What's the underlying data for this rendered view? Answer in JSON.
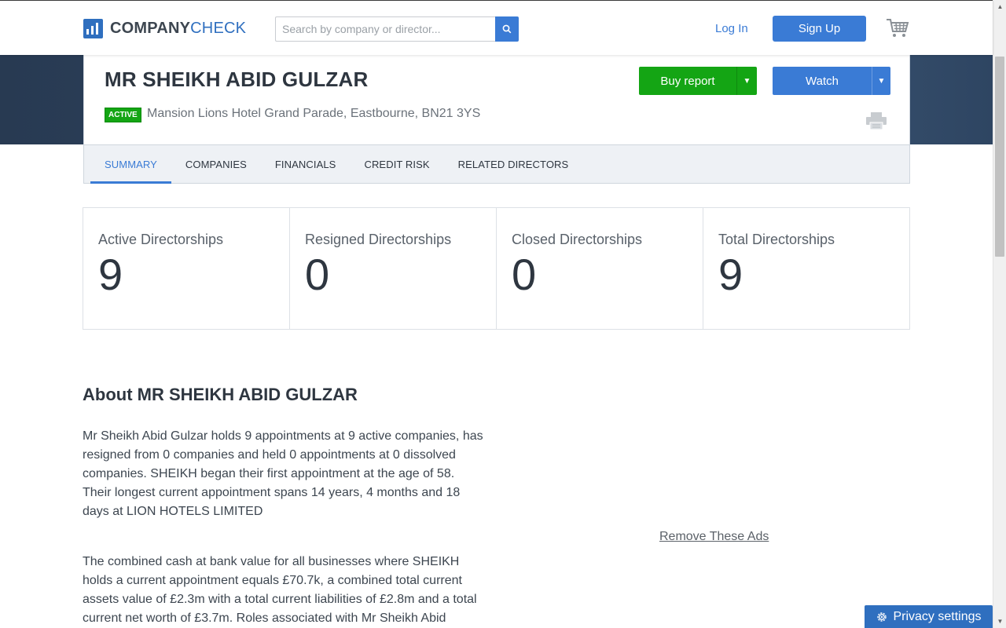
{
  "header": {
    "logo_part1": "COMPANY",
    "logo_part2": "CHECK",
    "search_placeholder": "Search by company or director...",
    "login_label": "Log In",
    "signup_label": "Sign Up"
  },
  "profile": {
    "name": "MR SHEIKH ABID GULZAR",
    "status": "ACTIVE",
    "address": "Mansion Lions Hotel Grand Parade, Eastbourne, BN21 3YS",
    "buy_label": "Buy report",
    "watch_label": "Watch"
  },
  "tabs": [
    {
      "label": "SUMMARY",
      "active": true
    },
    {
      "label": "COMPANIES",
      "active": false
    },
    {
      "label": "FINANCIALS",
      "active": false
    },
    {
      "label": "CREDIT RISK",
      "active": false
    },
    {
      "label": "RELATED DIRECTORS",
      "active": false
    }
  ],
  "stats": [
    {
      "label": "Active Directorships",
      "value": "9"
    },
    {
      "label": "Resigned Directorships",
      "value": "0"
    },
    {
      "label": "Closed Directorships",
      "value": "0"
    },
    {
      "label": "Total Directorships",
      "value": "9"
    }
  ],
  "about": {
    "title": "About MR SHEIKH ABID GULZAR",
    "paragraph1": "Mr Sheikh Abid Gulzar holds 9 appointments at 9 active companies, has resigned from 0 companies and held 0 appointments at 0 dissolved companies. SHEIKH began their first appointment at the age of 58. Their longest current appointment spans 14 years, 4 months and 18 days at LION HOTELS LIMITED",
    "paragraph2": "The combined cash at bank value for all businesses where SHEIKH holds a current appointment equals £70.7k, a combined total current assets value of £2.3m with a total current liabilities of £2.8m and a total current net worth of £3.7m. Roles associated with Mr Sheikh Abid"
  },
  "ads": {
    "remove_label": "Remove These Ads"
  },
  "privacy": {
    "label": "Privacy settings"
  },
  "colors": {
    "brand_blue": "#3a7bd5",
    "buy_green": "#14a514",
    "hero_dark": "#2d4360"
  }
}
